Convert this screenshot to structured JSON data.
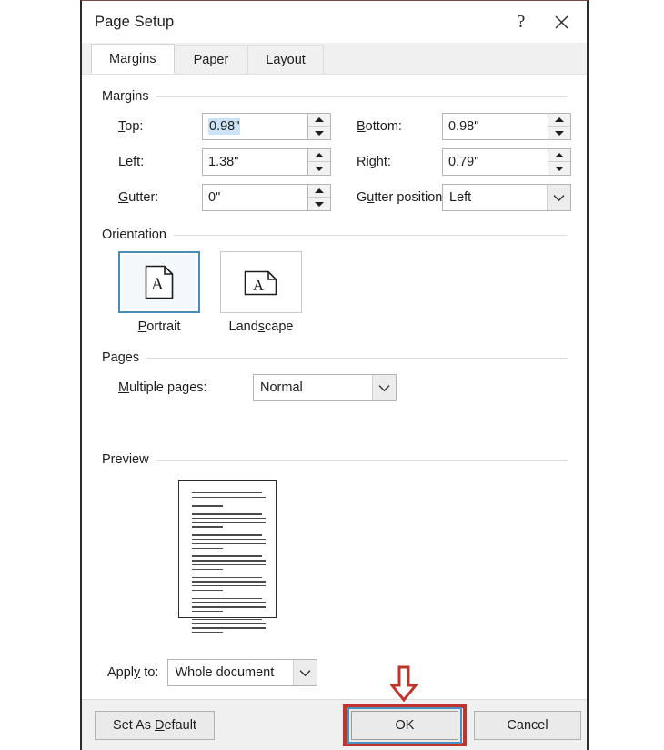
{
  "dialog": {
    "title": "Page Setup",
    "help_icon": "help-icon",
    "help_glyph": "?",
    "close_icon": "close-icon"
  },
  "tabs": [
    {
      "label": "Margins",
      "active": true
    },
    {
      "label": "Paper",
      "active": false
    },
    {
      "label": "Layout",
      "active": false
    }
  ],
  "margins": {
    "group_label": "Margins",
    "top": {
      "label_pre": "T",
      "label_key": "",
      "label": "Top:",
      "value": "0.98\"",
      "selected": true
    },
    "bottom": {
      "label": "Bottom:",
      "value": "0.98\"",
      "selected": false
    },
    "left": {
      "label": "Left:",
      "value": "1.38\"",
      "selected": false
    },
    "right": {
      "label": "Right:",
      "value": "0.79\"",
      "selected": false
    },
    "gutter": {
      "label": "Gutter:",
      "value": "0\"",
      "selected": false
    },
    "gutter_position": {
      "label": "Gutter position:",
      "value": "Left"
    }
  },
  "orientation": {
    "group_label": "Orientation",
    "options": [
      {
        "label": "Portrait",
        "selected": true
      },
      {
        "label": "Landscape",
        "selected": false
      }
    ]
  },
  "pages": {
    "group_label": "Pages",
    "multiple_pages": {
      "label": "Multiple pages:",
      "value": "Normal"
    }
  },
  "preview": {
    "group_label": "Preview"
  },
  "apply": {
    "label": "Apply to:",
    "value": "Whole document"
  },
  "footer": {
    "set_as_default": "Set As Default",
    "ok": "OK",
    "cancel": "Cancel"
  },
  "annotation": {
    "arrow_color": "#c0342b",
    "highlight_color": "#c0342b",
    "focus_color": "#4a90c4"
  },
  "colors": {
    "selection_highlight": "#cce3f7",
    "selected_border": "#4a8cb5",
    "panel_background": "#ffffff",
    "chrome_background": "#f0f0f0"
  }
}
